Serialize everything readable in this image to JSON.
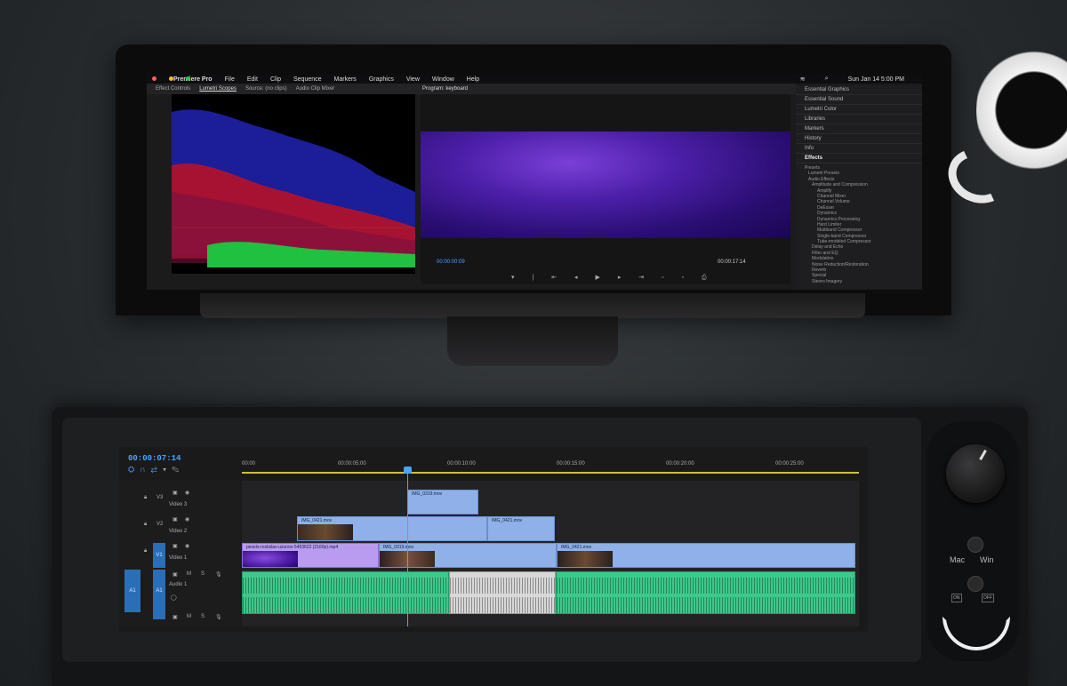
{
  "monitor": {
    "menu": {
      "app": "Premiere Pro",
      "items": [
        "File",
        "Edit",
        "Clip",
        "Sequence",
        "Markers",
        "Graphics",
        "View",
        "Window",
        "Help"
      ],
      "clock": "Sun Jan 14  5:00 PM"
    },
    "left_tabs": [
      "Effect Controls",
      "Lumetri Scopes",
      "Source: (no clips)",
      "Audio Clip Mixer"
    ],
    "program_tab": "Program: keyboard",
    "program": {
      "timecode_left": "00:00:00:09",
      "timecode_right": "00:00:17:14"
    },
    "right_panel": {
      "items": [
        "Essential Graphics",
        "Essential Sound",
        "Lumetri Color",
        "Libraries",
        "Markers",
        "History",
        "Info",
        "Effects"
      ],
      "effects_tree": [
        "Presets",
        "Lumetri Presets",
        "Audio Effects",
        "Amplitude and Compression",
        "Amplify",
        "Channel Mixer",
        "Channel Volume",
        "DeEsser",
        "Dynamics",
        "Dynamics Processing",
        "Hard Limiter",
        "Multiband Compressor",
        "Single-band Compressor",
        "Tube-modeled Compressor",
        "Delay and Echo",
        "Filter and EQ",
        "Modulation",
        "Noise Reduction/Restoration",
        "Reverb",
        "Special",
        "Stereo Imagery"
      ]
    }
  },
  "timeline": {
    "timecode": "00:00:07:14",
    "ruler": [
      "00:00",
      "00:00:05:00",
      "00:00:10:00",
      "00:00:15:00",
      "00:00:20:00",
      "00:00:25:00"
    ],
    "tracks": [
      {
        "id": "V3",
        "name": "Video 3"
      },
      {
        "id": "V2",
        "name": "Video 2"
      },
      {
        "id": "V1",
        "name": "Video 1"
      },
      {
        "id": "A1",
        "name": "Audio 1"
      }
    ],
    "source_target": "A1",
    "track_mute": "M",
    "track_solo": "S",
    "clips": {
      "v3": "IMG_0319.mov",
      "v2a": "IMG_0421.mov",
      "v2b": "IMG_0421.mov",
      "v1a": "pexels-rostislav-uzunov-5453622 (2160p).mp4",
      "v1b": "IMG_0319.mov",
      "v1c": "IMG_0421.mov"
    }
  },
  "device": {
    "switch_left": "Mac",
    "switch_right": "Win",
    "button_a": "ON",
    "button_b": "OFF"
  }
}
